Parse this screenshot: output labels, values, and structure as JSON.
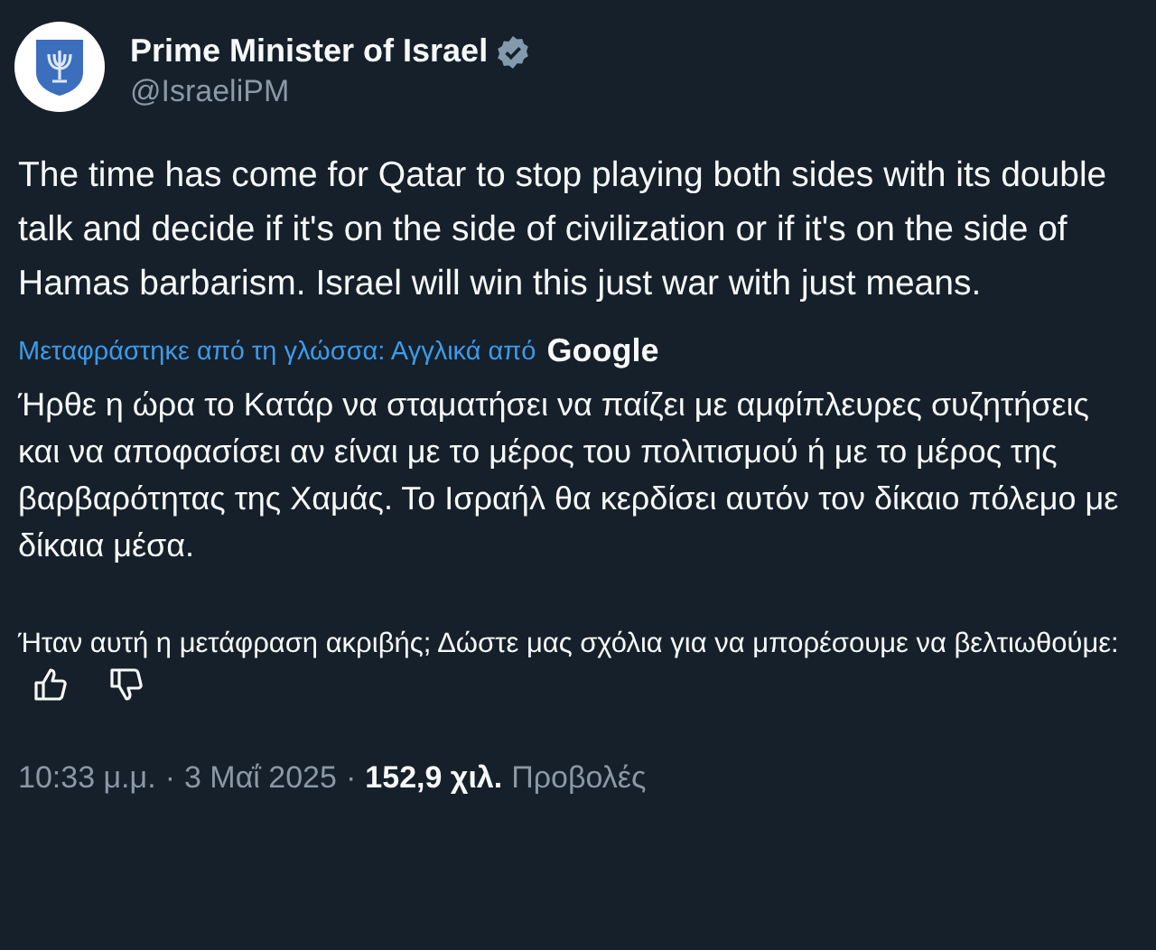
{
  "author": {
    "name": "Prime Minister of Israel",
    "handle": "@IsraeliPM",
    "verified": true
  },
  "text": "The time has come for Qatar to stop playing both sides with its double talk and decide if it's on the side of civilization or if it's on the side of Hamas barbarism. Israel will win this just war with just means.",
  "translation": {
    "label": "Μεταφράστηκε από τη γλώσσα: Αγγλικά από",
    "provider": "Google",
    "text": "Ήρθε η ώρα το Κατάρ να σταματήσει να παίζει με αμφίπλευρες συζητήσεις και να αποφασίσει αν είναι με το μέρος του πολιτισμού ή με το μέρος της βαρβαρότητας της Χαμάς. Το Ισραήλ θα κερδίσει αυτόν τον δίκαιο πόλεμο με δίκαια μέσα."
  },
  "feedback": {
    "prompt": "Ήταν αυτή η μετάφραση ακριβής; Δώστε μας σχόλια για να μπορέσουμε να βελτιωθούμε:"
  },
  "meta": {
    "time": "10:33 μ.μ.",
    "separator": "·",
    "date": "3 Μαΐ 2025",
    "views": "152,9 χιλ.",
    "views_label": "Προβολές"
  }
}
